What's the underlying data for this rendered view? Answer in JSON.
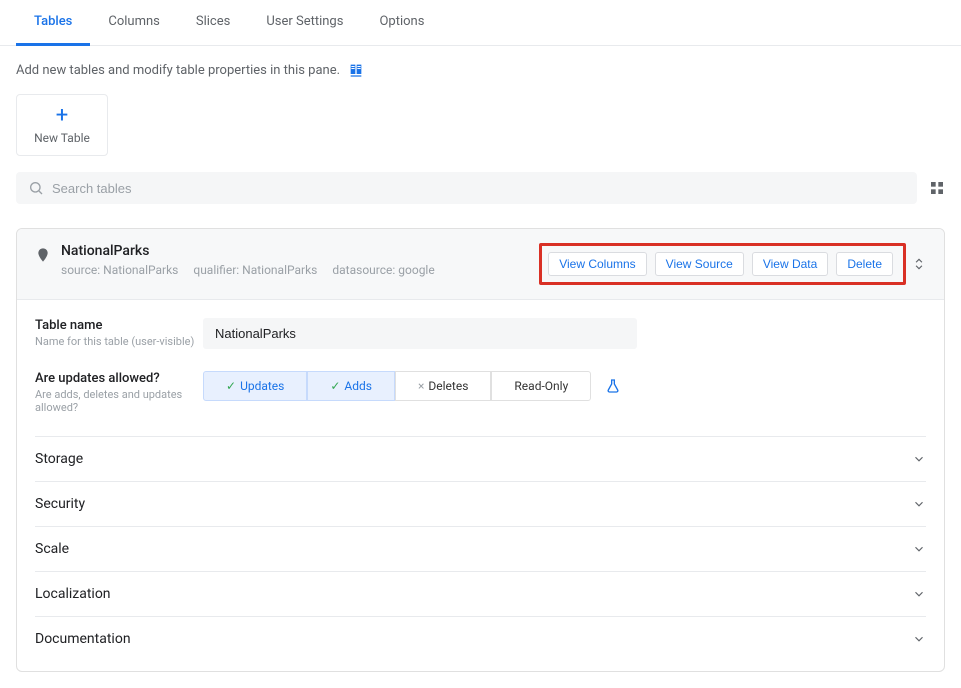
{
  "tabs": [
    "Tables",
    "Columns",
    "Slices",
    "User Settings",
    "Options"
  ],
  "activeTab": 0,
  "pane_desc": "Add new tables and modify table properties in this pane.",
  "new_table_label": "New Table",
  "search_placeholder": "Search tables",
  "table": {
    "title": "NationalParks",
    "meta": {
      "source_label": "source:",
      "source": "NationalParks",
      "qualifier_label": "qualifier:",
      "qualifier": "NationalParks",
      "datasource_label": "datasource:",
      "datasource": "google"
    },
    "actions": [
      "View Columns",
      "View Source",
      "View Data",
      "Delete"
    ]
  },
  "form": {
    "table_name": {
      "label": "Table name",
      "sub": "Name for this table (user-visible)",
      "value": "NationalParks"
    },
    "updates": {
      "label": "Are updates allowed?",
      "sub": "Are adds, deletes and updates allowed?",
      "options": {
        "updates": "Updates",
        "adds": "Adds",
        "deletes": "Deletes",
        "readonly": "Read-Only"
      }
    }
  },
  "accordion": [
    "Storage",
    "Security",
    "Scale",
    "Localization",
    "Documentation"
  ]
}
